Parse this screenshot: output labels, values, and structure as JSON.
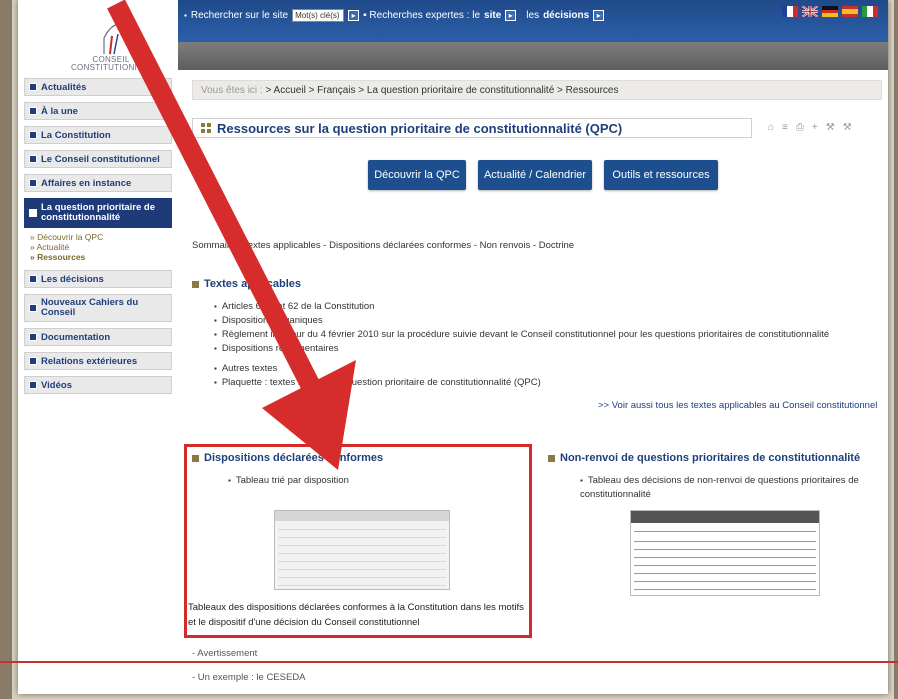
{
  "header": {
    "logo_line1": "CONSEIL",
    "logo_line2": "CONSTITUTIONNEL",
    "search_label": "Rechercher sur le site",
    "search_value": "Mot(s) clé(s)",
    "search_go": "▸",
    "expert_prefix": "▪ Recherches expertes : le",
    "expert_site": "site",
    "expert_go1": "▸",
    "expert_decisions_prefix": "les",
    "expert_decisions": "décisions",
    "expert_go2": "▸"
  },
  "flags": [
    "fr",
    "uk",
    "de",
    "es",
    "it"
  ],
  "sidebar": {
    "items": [
      {
        "label": "Actualités"
      },
      {
        "label": "À la une"
      },
      {
        "label": "La Constitution"
      },
      {
        "label": "Le Conseil constitutionnel"
      },
      {
        "label": "Affaires en instance"
      },
      {
        "label": "La question prioritaire de constitutionnalité"
      },
      {
        "label": "Les décisions"
      },
      {
        "label": "Nouveaux Cahiers du Conseil"
      },
      {
        "label": "Documentation"
      },
      {
        "label": "Relations extérieures"
      },
      {
        "label": "Vidéos"
      }
    ],
    "sub_items": [
      "» Découvrir la QPC",
      "» Actualité",
      "» Ressources"
    ]
  },
  "breadcrumb": {
    "prefix": "Vous êtes ici :",
    "path": "> Accueil > Français > La question prioritaire de constitutionnalité > Ressources"
  },
  "page_title": "Ressources sur la question prioritaire de constitutionnalité (QPC)",
  "tools": [
    "⌂",
    "≡",
    "⎙",
    "+",
    "⚒",
    "⚒"
  ],
  "tabs": [
    {
      "label": "Découvrir la QPC"
    },
    {
      "label": "Actualité / Calendrier"
    },
    {
      "label": "Outils et ressources"
    }
  ],
  "summary": "Sommaire : Textes applicables - Dispositions déclarées conformes - Non renvois - Doctrine",
  "textes": {
    "heading": "Textes applicables",
    "items": [
      "Articles 61-1 et 62 de la Constitution",
      "Dispositions organiques",
      "Règlement intérieur du 4 février 2010 sur la procédure suivie devant le Conseil constitutionnel pour les questions prioritaires de constitutionnalité",
      "Dispositions réglementaires"
    ],
    "items2": [
      "Autres textes",
      "Plaquette : textes relatifs à la question prioritaire de constitutionnalité (QPC)"
    ],
    "see_also": ">> Voir aussi tous les textes applicables au Conseil constitutionnel"
  },
  "conformes": {
    "heading": "Dispositions déclarées conformes",
    "item": "Tableau trié par disposition",
    "description": "Tableaux des dispositions déclarées conformes à la Constitution dans les motifs et le dispositif d'une décision du Conseil constitutionnel"
  },
  "non_renvoi": {
    "heading": "Non-renvoi de questions prioritaires de constitutionnalité",
    "item": "Tableau des décisions de non-renvoi de questions prioritaires de constitutionnalité"
  },
  "footer_links": [
    "- Avertissement",
    "- Un exemple : le CESEDA"
  ],
  "colors": {
    "accent": "#1d4f8e",
    "highlight": "#d42a2a",
    "arrow": "#d62c2c"
  }
}
